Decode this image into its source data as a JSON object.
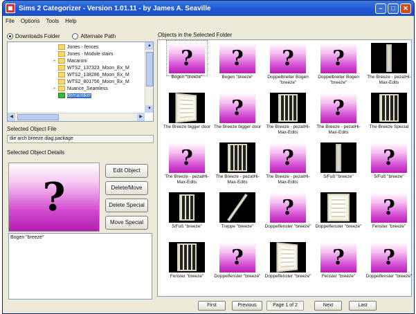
{
  "window": {
    "title": "Sims 2 Categorizer - Version 1.01.11 - by James A. Seaville",
    "minimize": "–",
    "maximize": "□",
    "close": "✕"
  },
  "menu": [
    "File",
    "Options",
    "Tools",
    "Help"
  ],
  "source": {
    "option1": "Downloads Folder",
    "option2": "Alternate Path",
    "selected": "Downloads Folder"
  },
  "tree": {
    "items": [
      {
        "label": "Jones - fences",
        "expander": ""
      },
      {
        "label": "Jones - Module stairs",
        "expander": ""
      },
      {
        "label": "Macaroni",
        "expander": "+"
      },
      {
        "label": "WTS2_137323_Moon_Ex_M",
        "expander": ""
      },
      {
        "label": "WTS2_138286_Moon_Ex_M",
        "expander": ""
      },
      {
        "label": "WTS2_801756_Moon_Ex_M",
        "expander": ""
      },
      {
        "label": "Nuance_Seamless",
        "expander": "+"
      },
      {
        "label": "demantiker",
        "expander": "",
        "selected": true
      }
    ]
  },
  "selected_file": {
    "label": "Selected Object File",
    "value": "die arch breeze diag.package"
  },
  "details": {
    "label": "Selected Object Details",
    "preview_glyph": "?",
    "description": "Bogen \"breeze\""
  },
  "actions": {
    "edit": "Edit Object",
    "delete_move": "Delete/Move",
    "delete_special": "Delete Special",
    "move_special": "Move Special"
  },
  "objects_label": "Objects in the Selected Folder",
  "objects": [
    {
      "caption": "Bogen \"breeze\"",
      "thumb": "unknown"
    },
    {
      "caption": "Bogen \"breeze\"",
      "thumb": "unknown"
    },
    {
      "caption": "Doppelbreiter Bogen \"breeze\"",
      "thumb": "unknown"
    },
    {
      "caption": "Doppelbreiter Bogen \"breeze\"",
      "thumb": "unknown"
    },
    {
      "caption": "The Breeze - pezatHi-Max-Edits",
      "thumb": "fence-tall"
    },
    {
      "caption": "The Breeze bigger door",
      "thumb": "door-persp"
    },
    {
      "caption": "The Breeze bigger door",
      "thumb": "unknown"
    },
    {
      "caption": "The Breeze - pezatHi-Max-Edits",
      "thumb": "fence"
    },
    {
      "caption": "The Breeze - pezatHi-Max-Edits",
      "thumb": "unknown"
    },
    {
      "caption": "The Breeze Special",
      "thumb": "fence"
    },
    {
      "caption": "The Breeze - pezatHi-Max-Edits",
      "thumb": "unknown"
    },
    {
      "caption": "The Breeze - pezatHi-Max-Edits",
      "thumb": "fence"
    },
    {
      "caption": "The Breeze - pezatHi-Max-Edits",
      "thumb": "unknown"
    },
    {
      "caption": "5/Fuß \"breeze\"",
      "thumb": "pole-tall"
    },
    {
      "caption": "5/Fuß \"breeze\"",
      "thumb": "unknown"
    },
    {
      "caption": "5/Fuß \"breeze\"",
      "thumb": "fence-small"
    },
    {
      "caption": "Treppe \"breeze\"",
      "thumb": "pole"
    },
    {
      "caption": "Doppelfenster \"breeze\"",
      "thumb": "unknown"
    },
    {
      "caption": "Doppelfenster \"breeze\"",
      "thumb": "door"
    },
    {
      "caption": "Fenster \"breeze\"",
      "thumb": "unknown"
    },
    {
      "caption": "Fenster \"breeze\"",
      "thumb": "fence"
    },
    {
      "caption": "Doppelfenster \"breeze\"",
      "thumb": "unknown"
    },
    {
      "caption": "Doppelfenster \"breeze\"",
      "thumb": "door-persp"
    },
    {
      "caption": "Fenster \"breeze\"",
      "thumb": "unknown"
    },
    {
      "caption": "Doppelfenster \"breeze\"",
      "thumb": "unknown"
    }
  ],
  "pager": {
    "first": "First",
    "previous": "Previous",
    "page": "Page 1 of 2",
    "next": "Next",
    "last": "Last"
  }
}
